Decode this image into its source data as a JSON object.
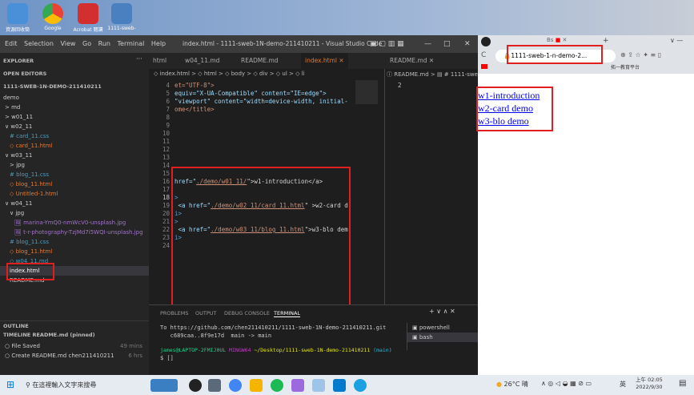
{
  "desktop": {
    "icons": [
      {
        "label": "資源回收筒",
        "color": "#4a90d9"
      },
      {
        "label": "Google",
        "color": "#e0e0e0"
      },
      {
        "label": "Acrobat 閱讀",
        "color": "#d32f2f"
      },
      {
        "label": "1111-sweb-",
        "color": "#4a80c0"
      }
    ]
  },
  "vscode": {
    "menu": [
      "Edit",
      "Selection",
      "View",
      "Go",
      "Run",
      "Terminal",
      "Help"
    ],
    "title": "index.html - 1111-sweb-1N-demo-211410211 - Visual Studio Code",
    "sidebar": {
      "explorer": "EXPLORER",
      "open_editors": "OPEN EDITORS",
      "project": "1111-SWEB-1N-DEMO-211410211",
      "items": [
        "demo",
        "> md",
        "> w01_11",
        "∨ w02_11",
        "# card_11.css",
        "◇ card_11.html",
        "∨ w03_11",
        "> jpg",
        "# blog_11.css",
        "◇ blog_11.html",
        "◇ Untitled-1.html",
        "∨ w04_11",
        "∨ jpg",
        "🖼 marina-YmQ0-nmWcV0-unsplash.jpg",
        "🖼 t-r-photography-TzjMd7i5WQI-unsplash.jpg",
        "# blog_11.css",
        "◇ blog_11.html",
        "◇ w04_11.md",
        "index.html",
        "README.md"
      ],
      "outline": "OUTLINE",
      "timeline": "TIMELINE  README.md (pinned)",
      "timeline_items": [
        {
          "label": "File Saved",
          "time": "49 mins"
        },
        {
          "label": "Create README.md  chen211410211",
          "time": "6 hrs"
        }
      ]
    },
    "tabs": [
      "html",
      "w04_11.md",
      "README.md",
      "index.html ✕",
      "README.md ✕"
    ],
    "breadcrumb": "◇ index.html > ◇ html > ◇ body > ◇ div > ◇ ul > ◇ li",
    "breadcrumb2": "ⓘ README.md > ▤ # 1111-sweb",
    "line_numbers": [
      "4",
      "5",
      "6",
      "7",
      "8",
      "9",
      "10",
      "11",
      "12",
      "13",
      "14",
      "15",
      "16",
      "17",
      "18",
      "19",
      "20",
      "21",
      "22",
      "23",
      "24"
    ],
    "code": {
      "l4": "et=\"UTF-8\">",
      "l5": "equiv=\"X-UA-Compatible\" content=\"IE=edge\">",
      "l6": "\"viewport\" content=\"width=device-width, initial-",
      "l7": "ome</title>",
      "l13a": "href=\"",
      "l13b": "./demo/w01_11/",
      "l13c": "\">w1-introduction</a>",
      "l15": ">",
      "l16a": " <a href=\"",
      "l16b": "./demo/w02_11/card_11.html",
      "l16c": "\" >w2-card d",
      "l17": "i>",
      "l18": ">",
      "l19a": " <a href=\"",
      "l19b": "./demo/w03_11/blog_11.html",
      "l19c": "\">w3-blo dem",
      "l20": "i>"
    },
    "split_line": "2",
    "panel": {
      "tabs": [
        "PROBLEMS",
        "OUTPUT",
        "DEBUG CONSOLE",
        "TERMINAL"
      ],
      "lines": [
        "To https://github.com/chen211410211/1111-sweb-1N-demo-211410211.git",
        "   c689caa..8f9e17d  main -> main"
      ],
      "prompt_user": "james@LAPTOP-2FMIJ0UL",
      "prompt_shell": "MINGW64",
      "prompt_path": "~/Desktop/1111-sweb-1N-demo-211410211",
      "prompt_branch": "(main)",
      "cursor": "$ []",
      "terminals": [
        "powershell",
        "bash"
      ]
    }
  },
  "browser": {
    "tab_label": "Bs",
    "url": "1111-sweb-1-n-demo-2...",
    "bookmark": "拓一教育平台",
    "links": [
      "w1-introduction",
      "w2-card demo",
      "w3-blo demo"
    ]
  },
  "taskbar": {
    "search": "在這裡輸入文字來搜尋",
    "weather": "26°C 晴",
    "ime": "英",
    "time": "上午 02:05",
    "date": "2022/9/30"
  }
}
